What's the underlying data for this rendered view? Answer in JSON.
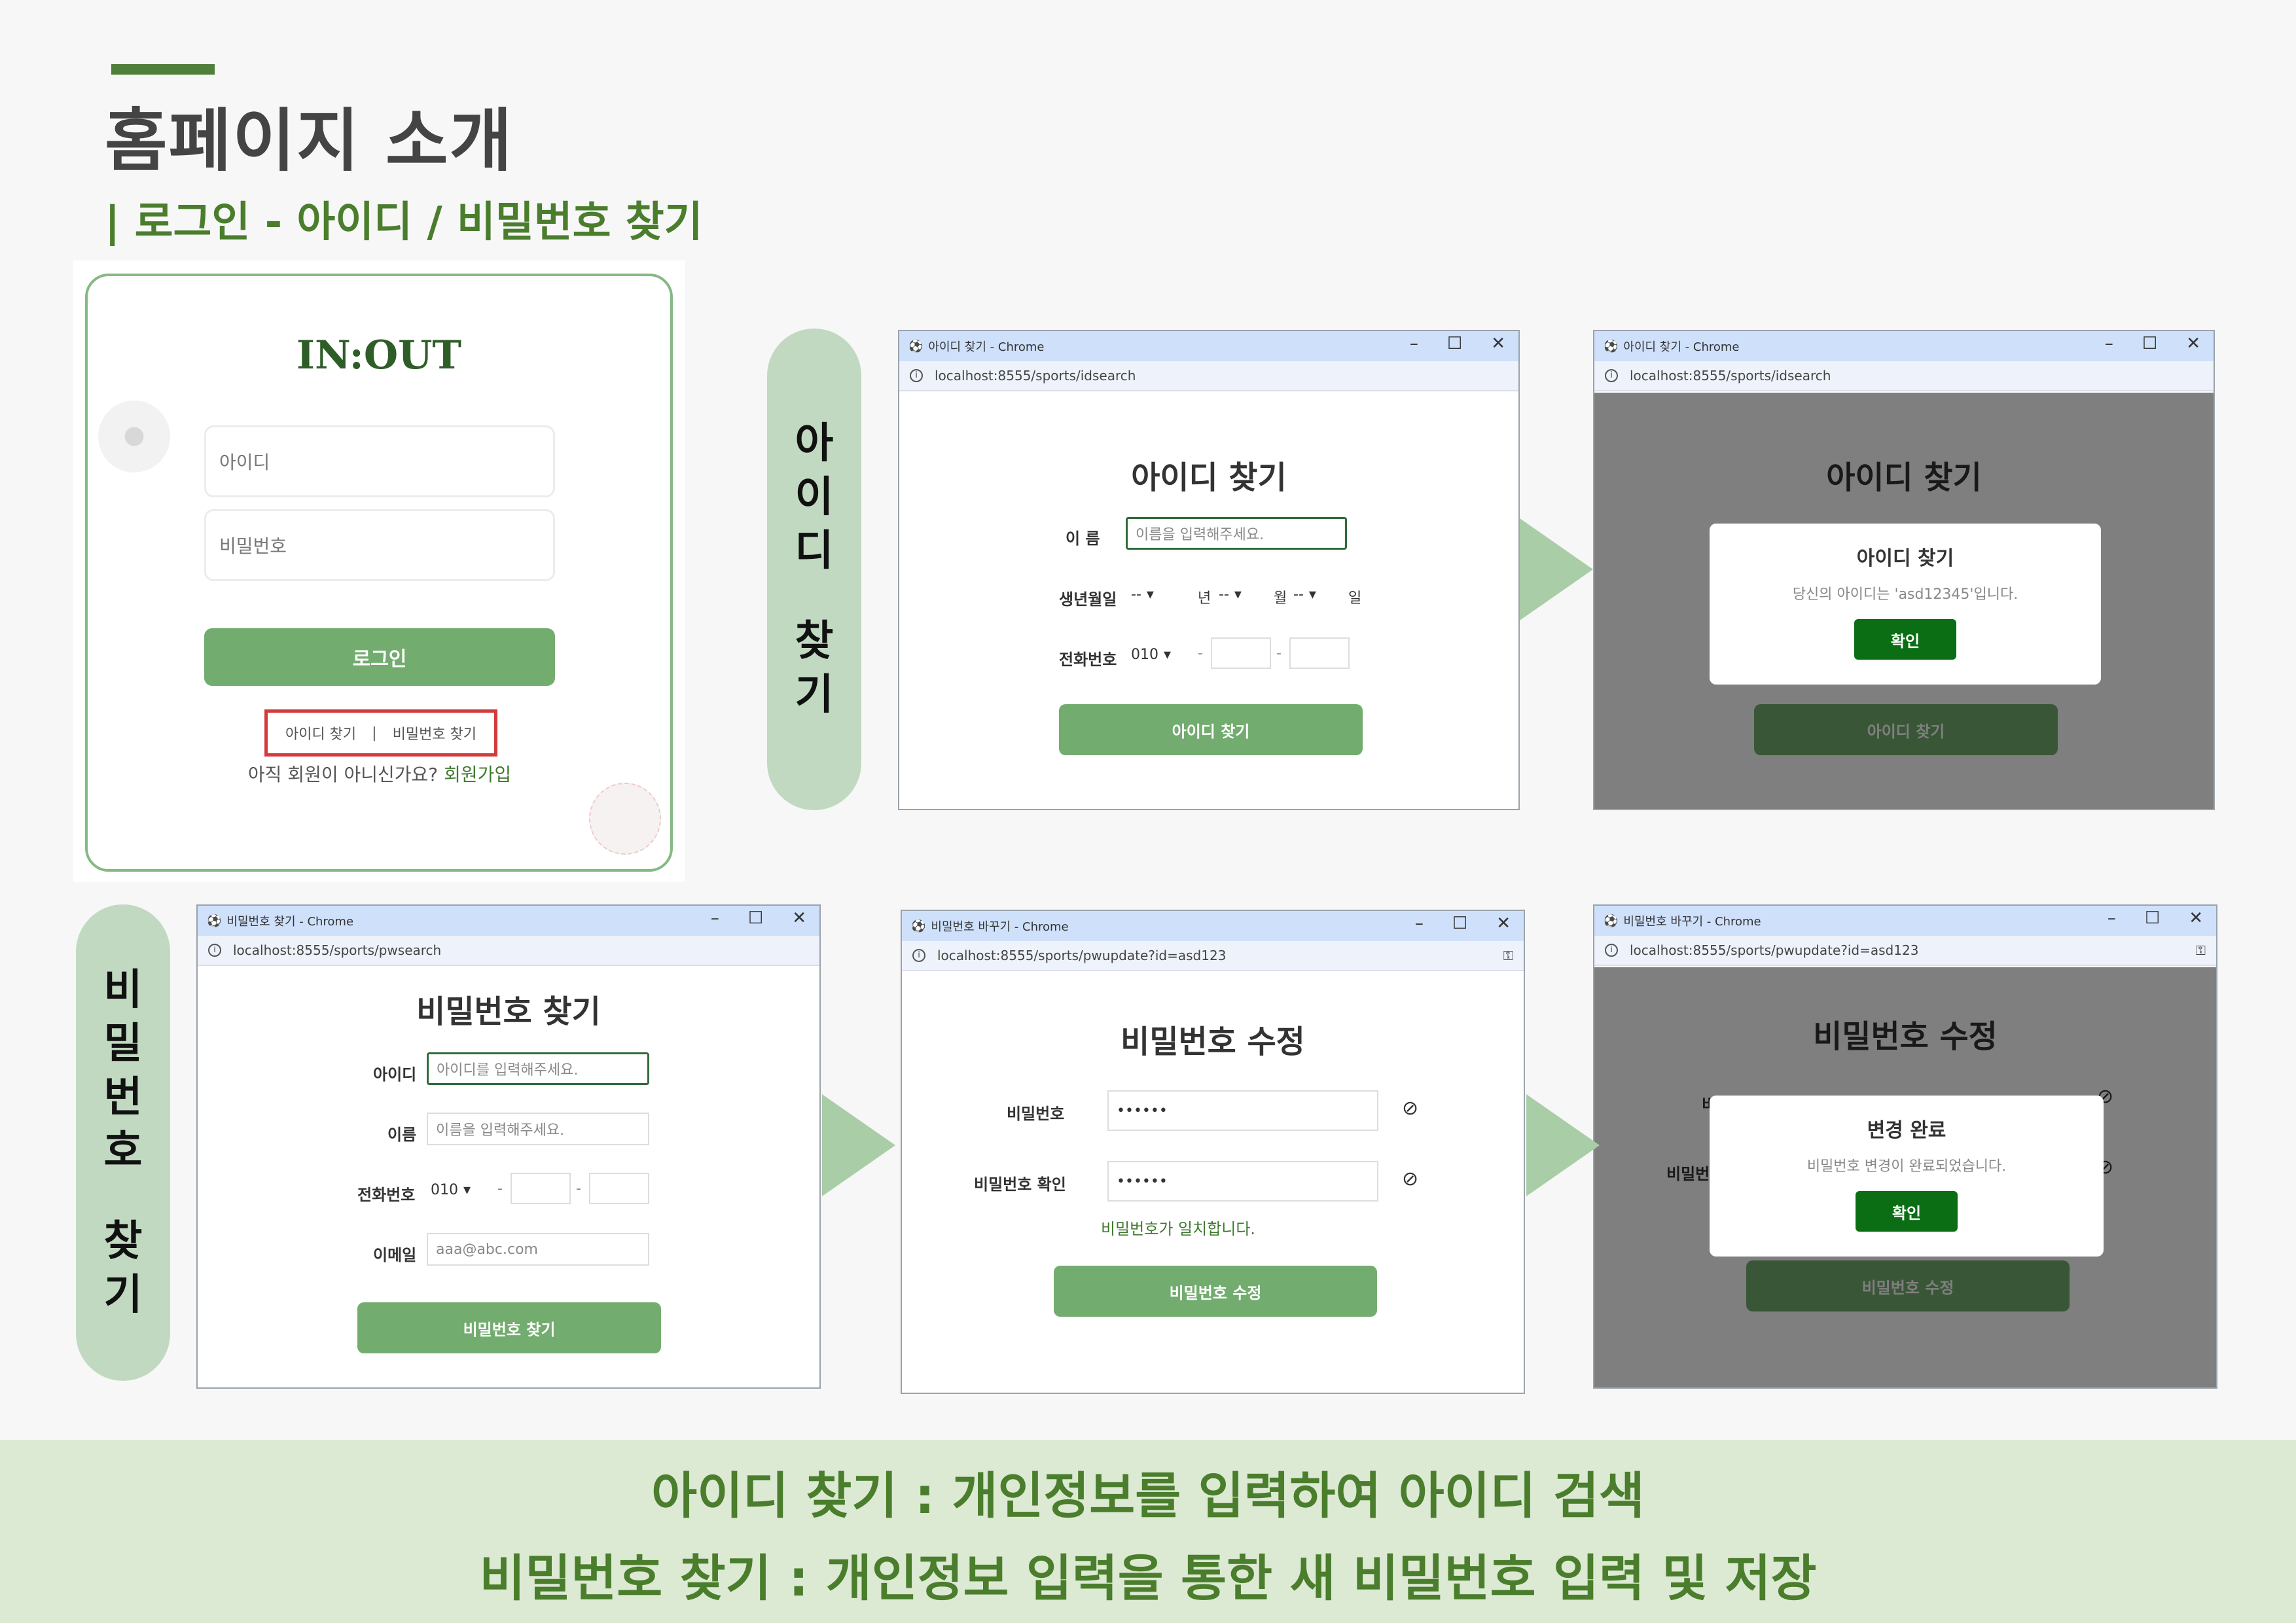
{
  "header": {
    "title": "홈페이지 소개",
    "subtitle": "| 로그인 - 아이디 / 비밀번호 찾기"
  },
  "login": {
    "logo": "IN:OUT",
    "id_placeholder": "아이디",
    "pw_placeholder": "비밀번호",
    "login_button": "로그인",
    "find_id_link": "아이디 찾기",
    "separator": "|",
    "find_pw_link": "비밀번호 찾기",
    "signup_prompt": "아직 회원이 아니신가요?",
    "signup_link": "회원가입"
  },
  "pills": {
    "id_lines": [
      "아",
      "이",
      "디",
      "찾",
      "기"
    ],
    "pw_lines": [
      "비",
      "밀",
      "번",
      "호",
      "찾",
      "기"
    ]
  },
  "win_id1": {
    "title": "아이디 찾기 - Chrome",
    "url": "localhost:8555/sports/idsearch",
    "heading": "아이디 찾기",
    "name_label": "이 름",
    "name_placeholder": "이름을 입력해주세요.",
    "birth_label": "생년월일",
    "birth_dash": "--",
    "year_label": "년",
    "month_label": "월",
    "day_label": "일",
    "phone_label": "전화번호",
    "phone_prefix": "010",
    "phone_sep": "-",
    "button": "아이디 찾기"
  },
  "win_id2": {
    "title": "아이디 찾기 - Chrome",
    "url": "localhost:8555/sports/idsearch",
    "heading": "아이디 찾기",
    "modal_title": "아이디 찾기",
    "modal_message": "당신의 아이디는 'asd12345'입니다.",
    "modal_button": "확인",
    "button": "아이디 찾기"
  },
  "win_pw1": {
    "title": "비밀번호 찾기 - Chrome",
    "url": "localhost:8555/sports/pwsearch",
    "heading": "비밀번호 찾기",
    "id_label": "아이디",
    "id_placeholder": "아이디를 입력해주세요.",
    "name_label": "이름",
    "name_placeholder": "이름을 입력해주세요.",
    "phone_label": "전화번호",
    "phone_prefix": "010",
    "phone_sep": "-",
    "email_label": "이메일",
    "email_placeholder": "aaa@abc.com",
    "button": "비밀번호 찾기"
  },
  "win_pw2": {
    "title": "비밀번호 바꾸기 - Chrome",
    "url": "localhost:8555/sports/pwupdate?id=asd123",
    "heading": "비밀번호 수정",
    "pw_label": "비밀번호",
    "pw_value": "••••••",
    "pw_confirm_label": "비밀번호 확인",
    "pw_confirm_value": "••••••",
    "match_text": "비밀번호가 일치합니다.",
    "button": "비밀번호 수정"
  },
  "win_pw3": {
    "title": "비밀번호 바꾸기 - Chrome",
    "url": "localhost:8555/sports/pwupdate?id=asd123",
    "heading": "비밀번호 수정",
    "bg_label1": "비",
    "bg_label2": "비밀번",
    "modal_title": "변경 완료",
    "modal_message": "비밀번호 변경이 완료되었습니다.",
    "modal_button": "확인",
    "button": "비밀번호 수정"
  },
  "window_controls": {
    "minimize": "–",
    "maximize": "☐",
    "close": "✕"
  },
  "footer": {
    "line1": "아이디 찾기 :  개인정보를 입력하여 아이디 검색",
    "line2": "비밀번호 찾기 : 개인정보 입력을 통한 새 비밀번호 입력 및 저장"
  },
  "colors": {
    "accent": "#4a7d2c",
    "button": "#73ac6f",
    "pill": "#c2d9c1",
    "arrow": "#a9cda6",
    "modal_button": "#0b6e14",
    "titlebar": "#cfe0fb"
  }
}
